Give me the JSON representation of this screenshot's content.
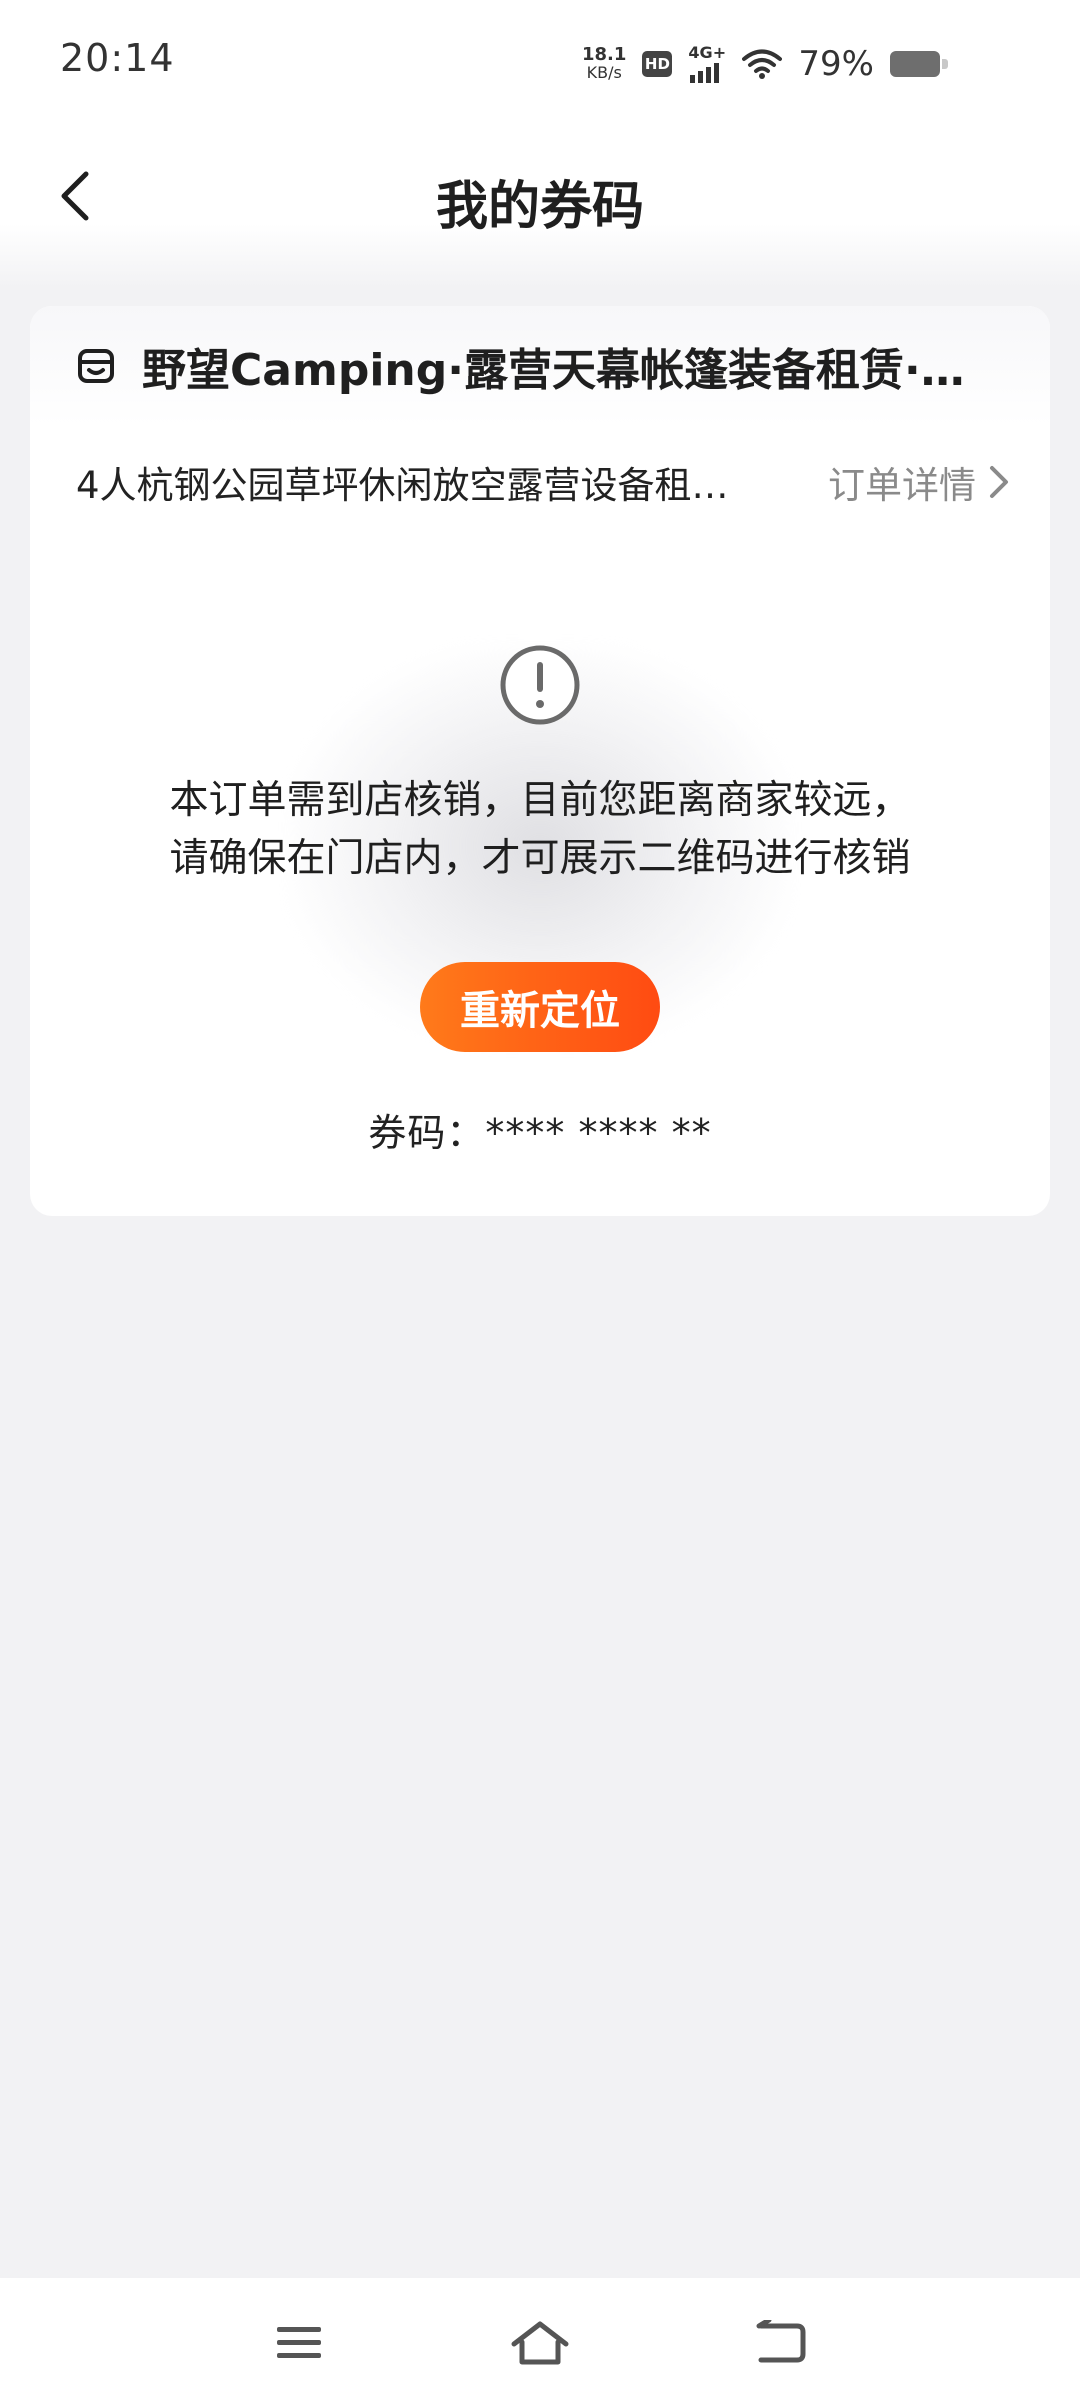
{
  "status_bar": {
    "time": "20:14",
    "net_speed_value": "18.1",
    "net_speed_unit": "KB/s",
    "hd_label": "HD",
    "network_label": "4G+",
    "battery_percent": "79%"
  },
  "header": {
    "title": "我的券码"
  },
  "card": {
    "store_name": "野望Camping·露营天幕帐篷装备租赁·烧…",
    "order_name": "4人杭钢公园草坪休闲放空露营设备租…",
    "order_detail_label": "订单详情",
    "notice_line1": "本订单需到店核销，目前您距离商家较远，",
    "notice_line2": "请确保在门店内，才可展示二维码进行核销",
    "relocate_label": "重新定位",
    "coupon_code_label": "券码：",
    "coupon_code_value": "**** **** **"
  },
  "colors": {
    "accent_start": "#ff7a1a",
    "accent_end": "#ff4b12",
    "background": "#f2f2f4",
    "secondary_text": "#8a8a8a"
  },
  "icons": {
    "back": "chevron-left-icon",
    "store": "store-icon",
    "detail_arrow": "chevron-right-icon",
    "warning": "exclamation-circle-icon",
    "nav_menu": "menu-icon",
    "nav_home": "home-icon",
    "nav_back": "back-icon"
  }
}
